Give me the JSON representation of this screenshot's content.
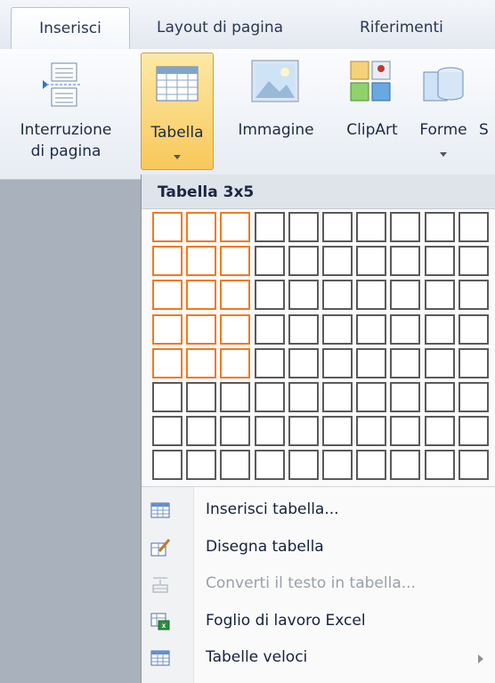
{
  "tabs": [
    {
      "label": "Inserisci",
      "active": true
    },
    {
      "label": "Layout di pagina",
      "active": false
    },
    {
      "label": "Riferimenti",
      "active": false
    }
  ],
  "ribbon": {
    "page_break": {
      "line1": "Interruzione",
      "line2": "di pagina"
    },
    "table": {
      "label": "Tabella"
    },
    "image": {
      "label": "Immagine"
    },
    "clipart": {
      "label": "ClipArt"
    },
    "shapes": {
      "label": "Forme"
    },
    "smartart_partial": {
      "label": "S"
    }
  },
  "table_dropdown": {
    "header": "Tabella 3x5",
    "grid": {
      "columns": 10,
      "rows": 8,
      "selected_columns": 3,
      "selected_rows": 5
    },
    "menu": [
      {
        "label": "Inserisci tabella...",
        "icon": "insert-table-icon",
        "enabled": true
      },
      {
        "label": "Disegna tabella",
        "icon": "draw-table-icon",
        "enabled": true
      },
      {
        "label": "Converti il testo in tabella...",
        "icon": "convert-text-icon",
        "enabled": false
      },
      {
        "label": "Foglio di lavoro Excel",
        "icon": "excel-sheet-icon",
        "enabled": true
      },
      {
        "label": "Tabelle veloci",
        "icon": "quick-tables-icon",
        "enabled": true,
        "has_submenu": true
      }
    ]
  },
  "colors": {
    "selection": "#f07a23",
    "pressed_button": "#f8c85a"
  }
}
